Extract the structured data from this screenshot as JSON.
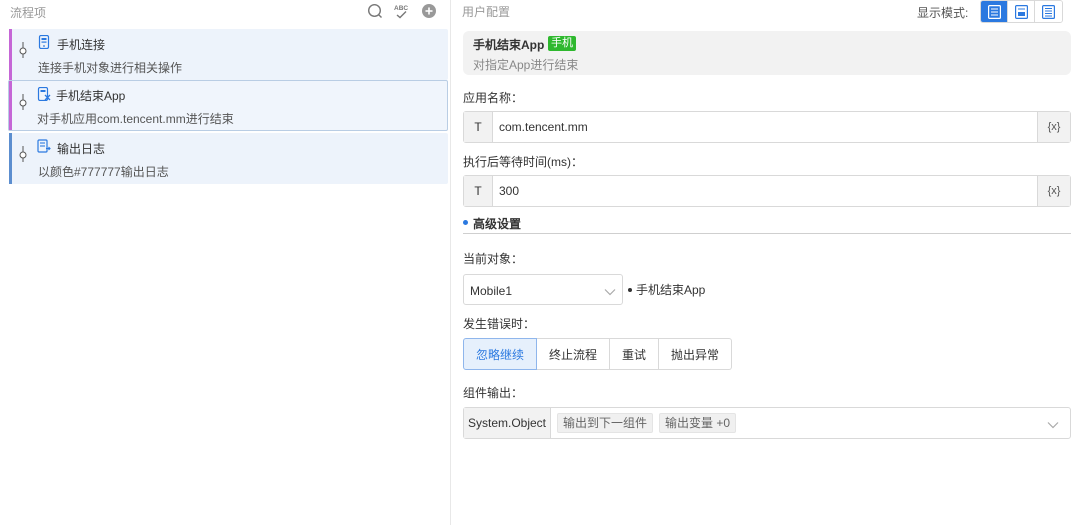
{
  "left_panel": {
    "title": "流程项",
    "header_icons": [
      "search-icon",
      "spellcheck-icon",
      "add-circle-icon"
    ],
    "steps": [
      {
        "title": "手机连接",
        "description": "连接手机对象进行相关操作",
        "bar_color": "#c566d6",
        "icon": "phone-connect-icon",
        "selected": false
      },
      {
        "title": "手机结束App",
        "description": "对手机应用com.tencent.mm进行结束",
        "bar_color": "#c566d6",
        "icon": "phone-close-app-icon",
        "selected": true
      },
      {
        "title": "输出日志",
        "description": "以颜色#777777输出日志",
        "bar_color": "#5c8ecf",
        "icon": "log-output-icon",
        "selected": false
      }
    ]
  },
  "right_panel": {
    "title": "用户配置",
    "display_mode": {
      "label": "显示模式:",
      "modes": [
        "mode-full-icon",
        "mode-compact-icon",
        "mode-list-icon"
      ],
      "active_index": 0
    },
    "component": {
      "title": "手机结束App",
      "tag": "手机",
      "tag_color": "#2eb82e",
      "description": "对指定App进行结束"
    },
    "app_name": {
      "label": "应用名称：",
      "prefix": "T",
      "value": "com.tencent.mm",
      "suffix": "{x}"
    },
    "wait_time": {
      "label": "执行后等待时间(ms)：",
      "prefix": "T",
      "value": "300",
      "suffix": "{x}"
    },
    "advanced": {
      "title": "高级设置",
      "current_object": {
        "label": "当前对象：",
        "value": "Mobile1",
        "target": "手机结束App"
      },
      "on_error": {
        "label": "发生错误时：",
        "options": [
          "忽略继续",
          "终止流程",
          "重试",
          "抛出异常"
        ],
        "selected_index": 0
      },
      "output": {
        "label": "组件输出：",
        "type": "System.Object",
        "chips": [
          "输出到下一组件",
          "输出变量 +0"
        ]
      }
    },
    "accent_color": "#2b79e0"
  }
}
